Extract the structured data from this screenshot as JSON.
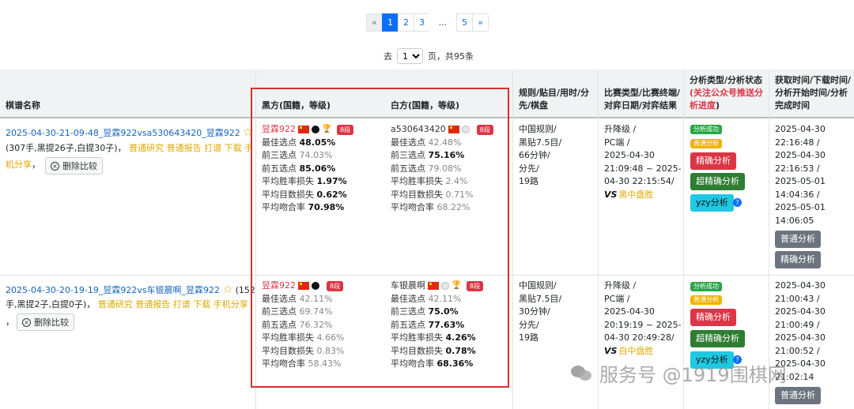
{
  "pagination": {
    "prev": "«",
    "pages": [
      "1",
      "2",
      "3"
    ],
    "ellipsis": "...",
    "last_page": "5",
    "next": "»",
    "goto_label": "去",
    "page_select_value": "1",
    "page_suffix": "页",
    "total_label": "，共95条"
  },
  "table": {
    "headers": {
      "name": "棋谱名称",
      "black": "黑方(国籍，等级)",
      "white": "白方(国籍，等级)",
      "rules": [
        "规则/贴目/用时/分",
        "先/棋盘"
      ],
      "match": [
        "比赛类型/比赛终端/",
        "对弈日期/对弈结果"
      ],
      "analysis_prefix": "分析类型/分析状态",
      "analysis_red": "(关注公众号推送分",
      "analysis_red2": "析进度",
      "analysis_suffix": ")",
      "times": [
        "获取时间/下载时间/",
        "分析开始时间/分析",
        "完成时间"
      ]
    },
    "rows": [
      {
        "title": "2025-04-30-21-09-48_昱霖922vsa530643420_昱霖922",
        "line2_prefix": "(307手,黑提26子,白提30子)，",
        "links": "普通研究 普通报告 打谱 下载 手",
        "line3_link": "机分享",
        "line3_suffix": "，",
        "delete_label": "删除比较",
        "black": {
          "name": "昱霖922",
          "dan": "8段",
          "stats": [
            {
              "label": "最佳选点",
              "value": "48.05%",
              "bold": true
            },
            {
              "label": "前三选点",
              "value": "74.03%",
              "bold": false
            },
            {
              "label": "前五选点",
              "value": "85.06%",
              "bold": true
            },
            {
              "label": "平均胜率损失",
              "value": "1.97%",
              "bold": true
            },
            {
              "label": "平均目数损失",
              "value": "0.62%",
              "bold": true
            },
            {
              "label": "平均吻合率",
              "value": "70.98%",
              "bold": true
            }
          ]
        },
        "white": {
          "name": "a530643420",
          "dan": "8段",
          "stats": [
            {
              "label": "最佳选点",
              "value": "42.48%",
              "bold": false
            },
            {
              "label": "前三选点",
              "value": "75.16%",
              "bold": true
            },
            {
              "label": "前五选点",
              "value": "79.08%",
              "bold": false
            },
            {
              "label": "平均胜率损失",
              "value": "2.4%",
              "bold": false
            },
            {
              "label": "平均目数损失",
              "value": "0.71%",
              "bold": false
            },
            {
              "label": "平均吻合率",
              "value": "68.22%",
              "bold": false
            }
          ]
        },
        "rules": [
          "中国规则/",
          "黑贴7.5目/",
          "66分钟/",
          "分先/",
          "19路"
        ],
        "match": [
          "升降级 /",
          "PC端 /",
          "2025-04-30",
          "21:09:48 ~ 2025-",
          "04-30 22:15:54/"
        ],
        "vs": "VS",
        "result": "黑中盘胜",
        "status_badges": [
          "分析成功",
          "普通分析"
        ],
        "buttons": [
          "精确分析",
          "超精确分析",
          "yzy分析"
        ],
        "help": "?",
        "times": [
          "2025-04-30",
          "22:16:48 /",
          "2025-04-30",
          "22:16:53 /",
          "2025-05-01",
          "14:04:36 /",
          "2025-05-01",
          "14:06:05"
        ],
        "grey_buttons": [
          "普通分析",
          "精确分析"
        ]
      },
      {
        "title": "2025-04-30-20-19-19_昱霖922vs车银晨啊_昱霖922",
        "title_suffix": "(152",
        "line2_prefix": "手,黑提2子,白提0子)，",
        "links": "普通研究 普通报告 打谱 下载 手机分享",
        "line3_suffix": "，",
        "delete_label": "删除比较",
        "black": {
          "name": "昱霖922",
          "dan": "8段",
          "stats": [
            {
              "label": "最佳选点",
              "value": "42.11%",
              "bold": false
            },
            {
              "label": "前三选点",
              "value": "69.74%",
              "bold": false
            },
            {
              "label": "前五选点",
              "value": "76.32%",
              "bold": false
            },
            {
              "label": "平均胜率损失",
              "value": "4.66%",
              "bold": false
            },
            {
              "label": "平均目数损失",
              "value": "0.83%",
              "bold": false
            },
            {
              "label": "平均吻合率",
              "value": "58.43%",
              "bold": false
            }
          ]
        },
        "white": {
          "name": "车银晨啊",
          "dan": "8段",
          "stats": [
            {
              "label": "最佳选点",
              "value": "42.11%",
              "bold": false
            },
            {
              "label": "前三选点",
              "value": "75.0%",
              "bold": true
            },
            {
              "label": "前五选点",
              "value": "77.63%",
              "bold": true
            },
            {
              "label": "平均胜率损失",
              "value": "4.26%",
              "bold": true
            },
            {
              "label": "平均目数损失",
              "value": "0.78%",
              "bold": true
            },
            {
              "label": "平均吻合率",
              "value": "68.36%",
              "bold": true
            }
          ]
        },
        "rules": [
          "中国规则/",
          "黑贴7.5目/",
          "30分钟/",
          "分先/",
          "19路"
        ],
        "match": [
          "升降级 /",
          "PC端 /",
          "2025-04-30",
          "20:19:19 ~ 2025-",
          "04-30 20:49:28/"
        ],
        "vs": "VS",
        "result": "白中盘胜",
        "status_badges": [
          "分析成功",
          "普通分析"
        ],
        "buttons": [
          "精确分析",
          "超精确分析",
          "yzy分析"
        ],
        "help": "?",
        "times": [
          "2025-04-30",
          "21:00:43 /",
          "2025-04-30",
          "21:00:49 /",
          "2025-04-30",
          "21:00:52 /",
          "2025-04-30",
          "21:02:14"
        ],
        "grey_buttons": [
          "普通分析"
        ]
      }
    ]
  },
  "watermark": "服务号 @1919围棋网"
}
